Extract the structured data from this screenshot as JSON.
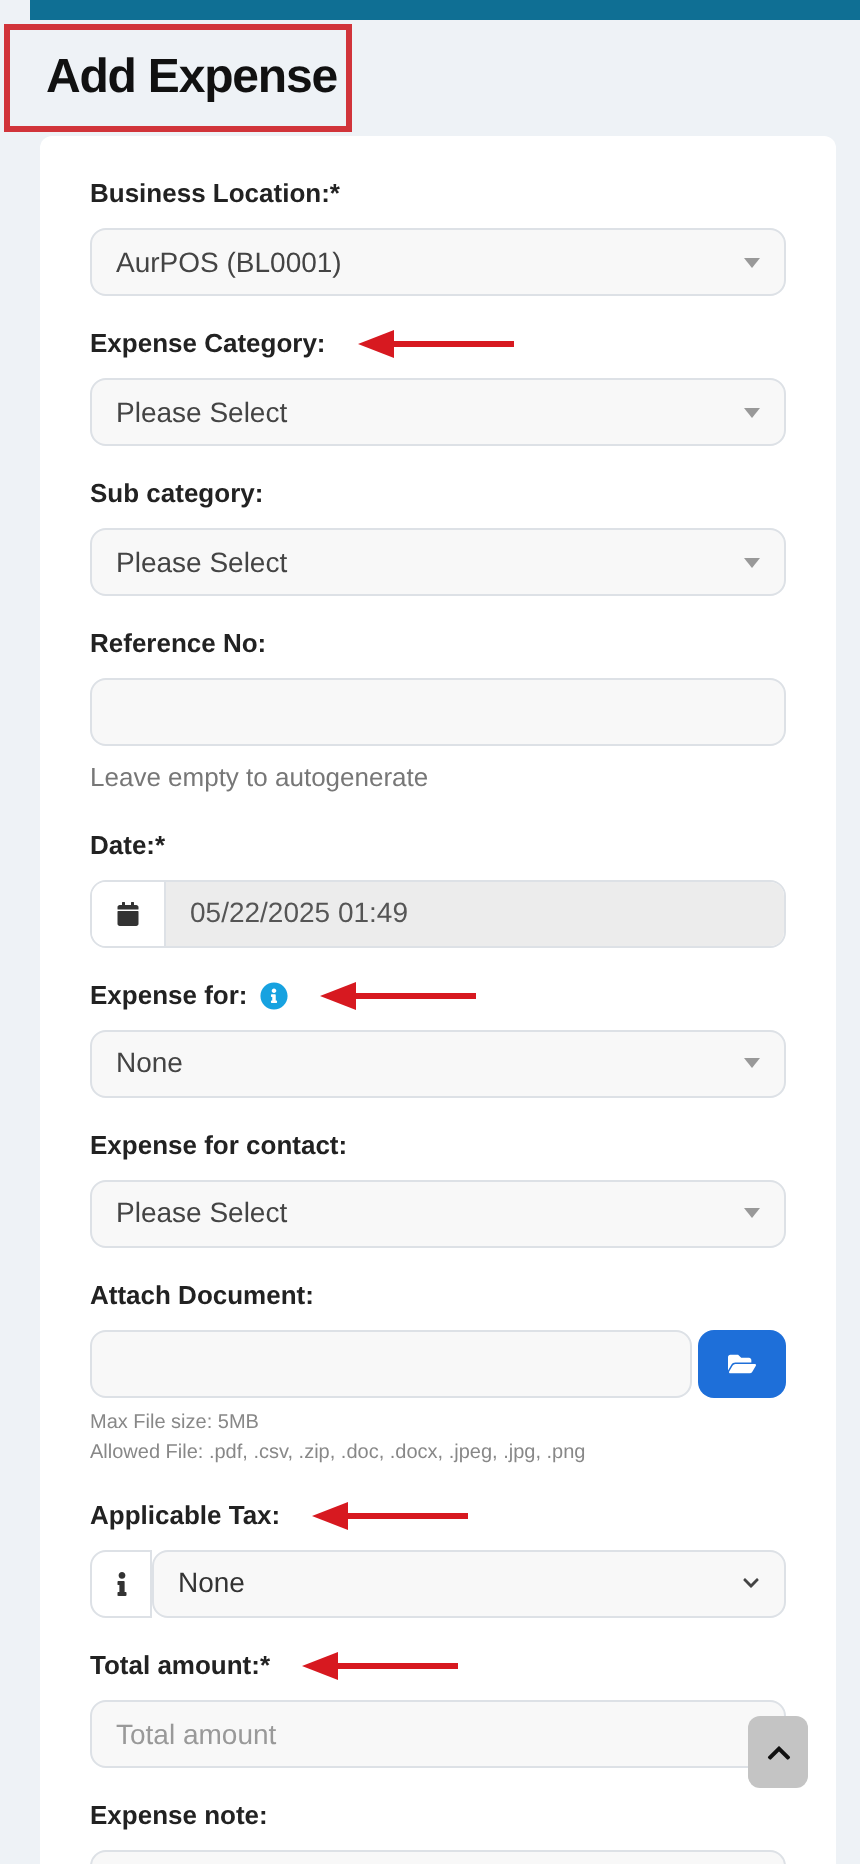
{
  "title": "Add Expense",
  "fields": [
    {
      "kind": "select",
      "label": "Business Location:*",
      "value": "AurPOS (BL0001)",
      "arrow": false
    },
    {
      "kind": "select",
      "label": "Expense Category:",
      "value": "Please Select",
      "arrow": true
    },
    {
      "kind": "select",
      "label": "Sub category:",
      "value": "Please Select",
      "arrow": false
    },
    {
      "kind": "input",
      "label": "Reference No:",
      "help": [
        "Leave empty to autogenerate"
      ],
      "arrow": false
    },
    {
      "kind": "date",
      "label": "Date:*",
      "value": "05/22/2025 01:49",
      "arrow": false
    },
    {
      "kind": "select",
      "label": "Expense for:",
      "info": true,
      "value": "None",
      "arrow": true
    },
    {
      "kind": "select",
      "label": "Expense for contact:",
      "value": "Please Select",
      "arrow": false
    },
    {
      "kind": "file",
      "label": "Attach Document:",
      "help": [
        "Max File size: 5MB",
        "Allowed File: .pdf, .csv, .zip, .doc, .docx, .jpeg, .jpg, .png"
      ],
      "arrow": false
    },
    {
      "kind": "tax",
      "label": "Applicable Tax:",
      "value": "None",
      "arrow": true
    },
    {
      "kind": "input",
      "label": "Total amount:*",
      "placeholder": "Total amount",
      "arrow": true
    },
    {
      "kind": "textarea",
      "label": "Expense note:",
      "arrow": false
    }
  ]
}
